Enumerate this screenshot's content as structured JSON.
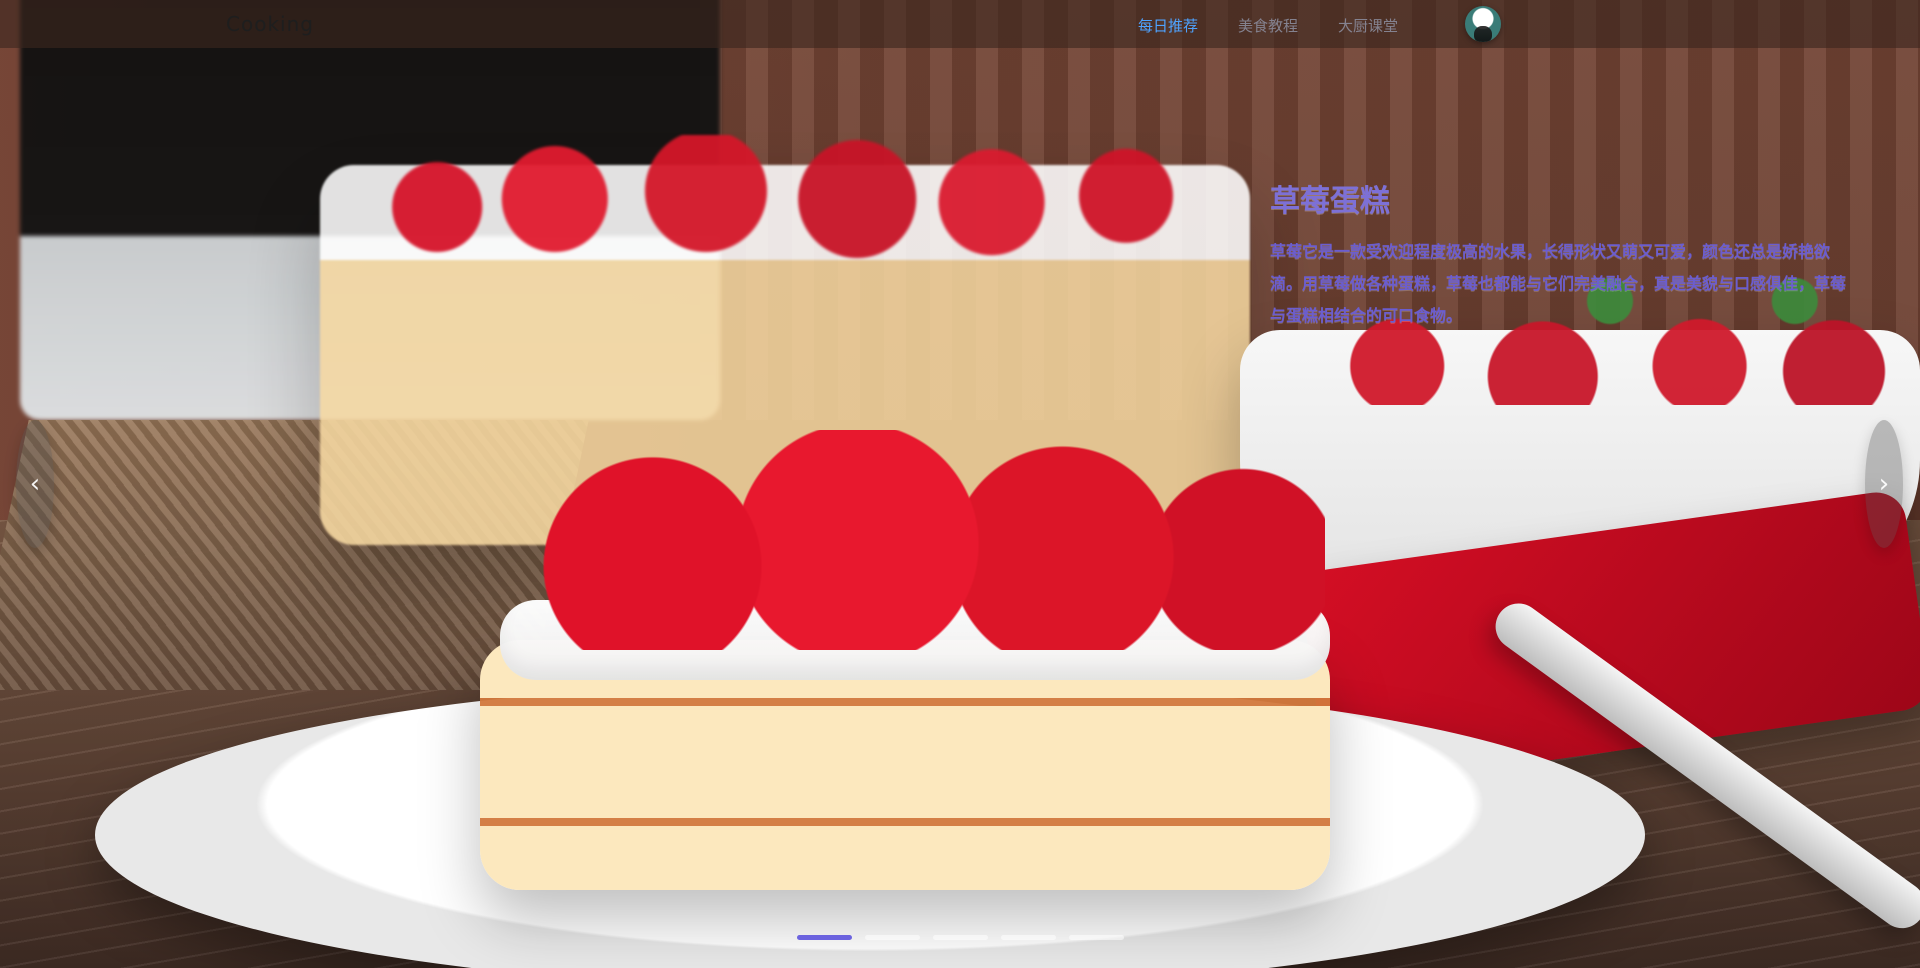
{
  "header": {
    "brand": "Cooking",
    "nav": [
      {
        "label": "每日推荐",
        "active": true
      },
      {
        "label": "美食教程",
        "active": false
      },
      {
        "label": "大厨课堂",
        "active": false
      }
    ],
    "avatar_icon": "user-avatar-icon"
  },
  "hero": {
    "title": "草莓蛋糕",
    "description": "草莓它是一款受欢迎程度极高的水果，长得形状又萌又可爱，颜色还总是娇艳欲滴。用草莓做各种蛋糕，草莓也都能与它们完美融合，真是美貌与口感俱佳，草莓与蛋糕相结合的可口食物。"
  },
  "carousel": {
    "prev_icon": "chevron-left-icon",
    "next_icon": "chevron-right-icon",
    "prev_glyph": "‹",
    "next_glyph": "›",
    "slides": 5,
    "active_index": 0
  },
  "colors": {
    "nav_active": "#4ea3ff",
    "caption": "#6b5dcf",
    "dot_active": "#6c63df"
  }
}
